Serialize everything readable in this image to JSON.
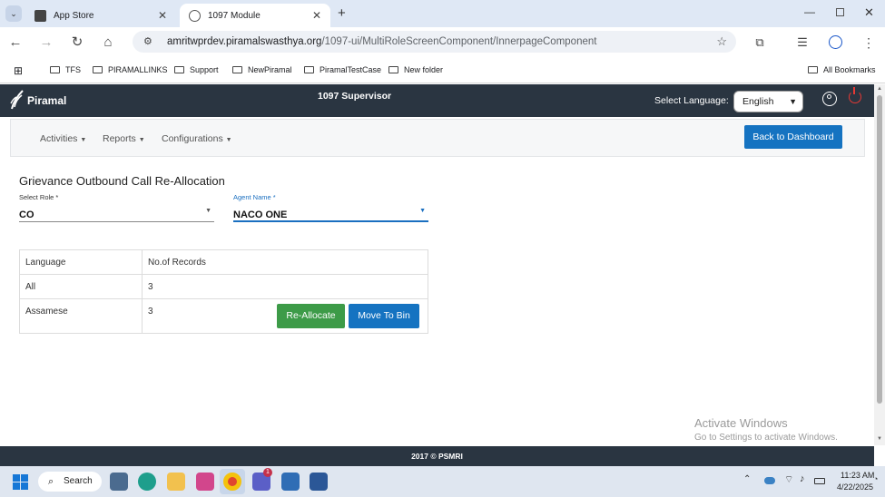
{
  "browser": {
    "tabs": [
      {
        "title": "App Store",
        "active": false
      },
      {
        "title": "1097 Module",
        "active": true
      }
    ],
    "url": "amritwprdev.piramalswasthya.org/1097-ui/MultiRoleScreenComponent/InnerpageComponent",
    "url_host": "amritwprdev.piramalswasthya.org",
    "url_path": "/1097-ui/MultiRoleScreenComponent/InnerpageComponent",
    "bookmarks": [
      "TFS",
      "PIRAMALLINKS",
      "Support",
      "NewPiramal",
      "PiramalTestCase",
      "New folder"
    ],
    "all_bookmarks": "All Bookmarks"
  },
  "header": {
    "logo_text": "Piramal",
    "title": "1097 Supervisor",
    "language_label": "Select Language:",
    "language_value": "English"
  },
  "menu": {
    "items": [
      "Activities",
      "Reports",
      "Configurations"
    ],
    "back_button": "Back to Dashboard"
  },
  "page": {
    "title": "Grievance Outbound Call Re-Allocation",
    "role_label": "Select Role *",
    "role_value": "CO",
    "agent_label": "Agent Name *",
    "agent_value": "NACO ONE"
  },
  "table": {
    "headers": [
      "Language",
      "No.of Records"
    ],
    "rows": [
      {
        "language": "All",
        "records": "3"
      },
      {
        "language": "Assamese",
        "records": "3"
      }
    ],
    "reallocate_button": "Re-Allocate",
    "bin_button": "Move To Bin"
  },
  "watermark": {
    "line1": "Activate Windows",
    "line2": "Go to Settings to activate Windows."
  },
  "footer": {
    "text": "2017 © PSMRI"
  },
  "taskbar": {
    "search": "Search",
    "time": "11:23 AM",
    "date": "4/22/2025",
    "teams_badge": "1"
  },
  "colors": {
    "header_bg": "#2a3541",
    "primary": "#1573c1",
    "success": "#3d9b48",
    "power": "#e53935"
  }
}
